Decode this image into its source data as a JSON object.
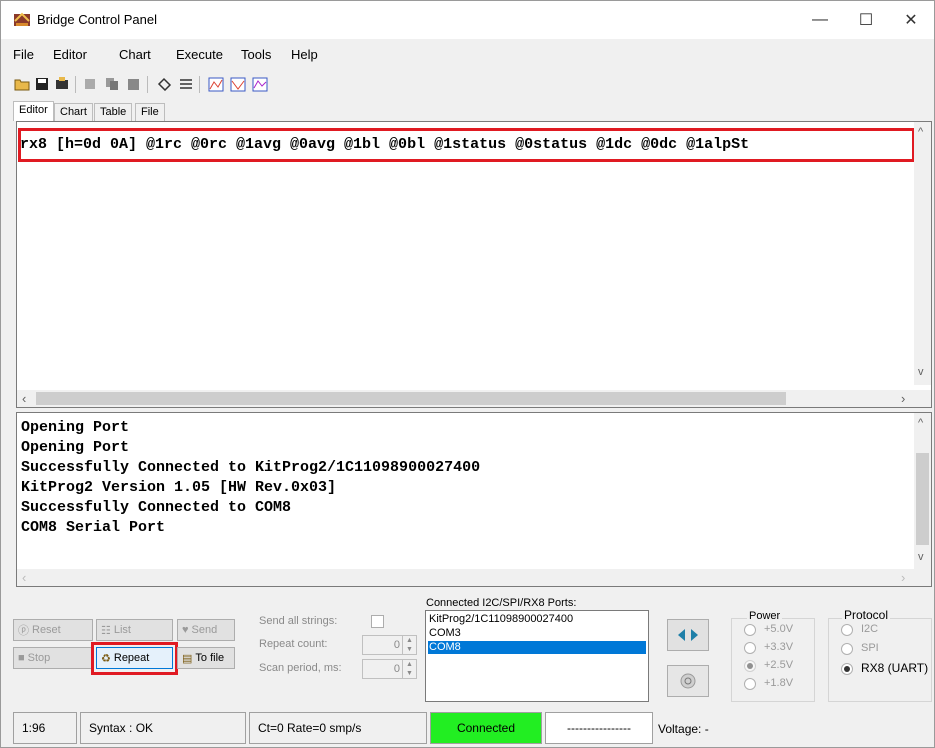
{
  "window": {
    "title": "Bridge Control Panel",
    "min": "—",
    "max": "☐",
    "close": "✕"
  },
  "menu": [
    {
      "label": "File"
    },
    {
      "label": "Editor"
    },
    {
      "label": "Chart"
    },
    {
      "label": "Execute"
    },
    {
      "label": "Tools"
    },
    {
      "label": "Help"
    }
  ],
  "tabs": [
    "Editor",
    "Chart",
    "Table",
    "File"
  ],
  "editor": {
    "line": "rx8 [h=0d 0A] @1rc @0rc @1avg @0avg @1bl @0bl @1status @0status @1dc @0dc @1alpSt"
  },
  "log": {
    "lines": [
      "Opening Port",
      "Opening Port",
      "Successfully Connected to KitProg2/1C11098900027400",
      "KitProg2 Version 1.05 [HW Rev.0x03]",
      "Successfully Connected to COM8",
      "COM8 Serial Port"
    ]
  },
  "controls": {
    "reset": "Reset",
    "list": "List",
    "send": "Send",
    "stop": "Stop",
    "repeat": "Repeat",
    "to_file": "To file",
    "send_all_strings": "Send all strings:",
    "repeat_count_label": "Repeat count:",
    "repeat_count": "0",
    "scan_period_label": "Scan period, ms:",
    "scan_period": "0"
  },
  "ports": {
    "label": "Connected I2C/SPI/RX8 Ports:",
    "items": [
      "KitProg2/1C11098900027400",
      "COM3",
      "COM8"
    ],
    "selected": "COM8"
  },
  "power": {
    "title": "Power",
    "options": [
      "+5.0V",
      "+3.3V",
      "+2.5V",
      "+1.8V"
    ]
  },
  "protocol": {
    "title": "Protocol",
    "options": [
      "I2C",
      "SPI",
      "RX8 (UART)"
    ],
    "selected": "RX8 (UART)"
  },
  "status": {
    "position": "1:96",
    "syntax": "Syntax : OK",
    "rate": "Ct=0 Rate=0 smp/s",
    "connection": "Connected",
    "dashes": "----------------",
    "voltage": "Voltage: -"
  },
  "colors": {
    "highlight": "#e01a22",
    "connected": "#22ee22",
    "selection": "#0078d7"
  }
}
